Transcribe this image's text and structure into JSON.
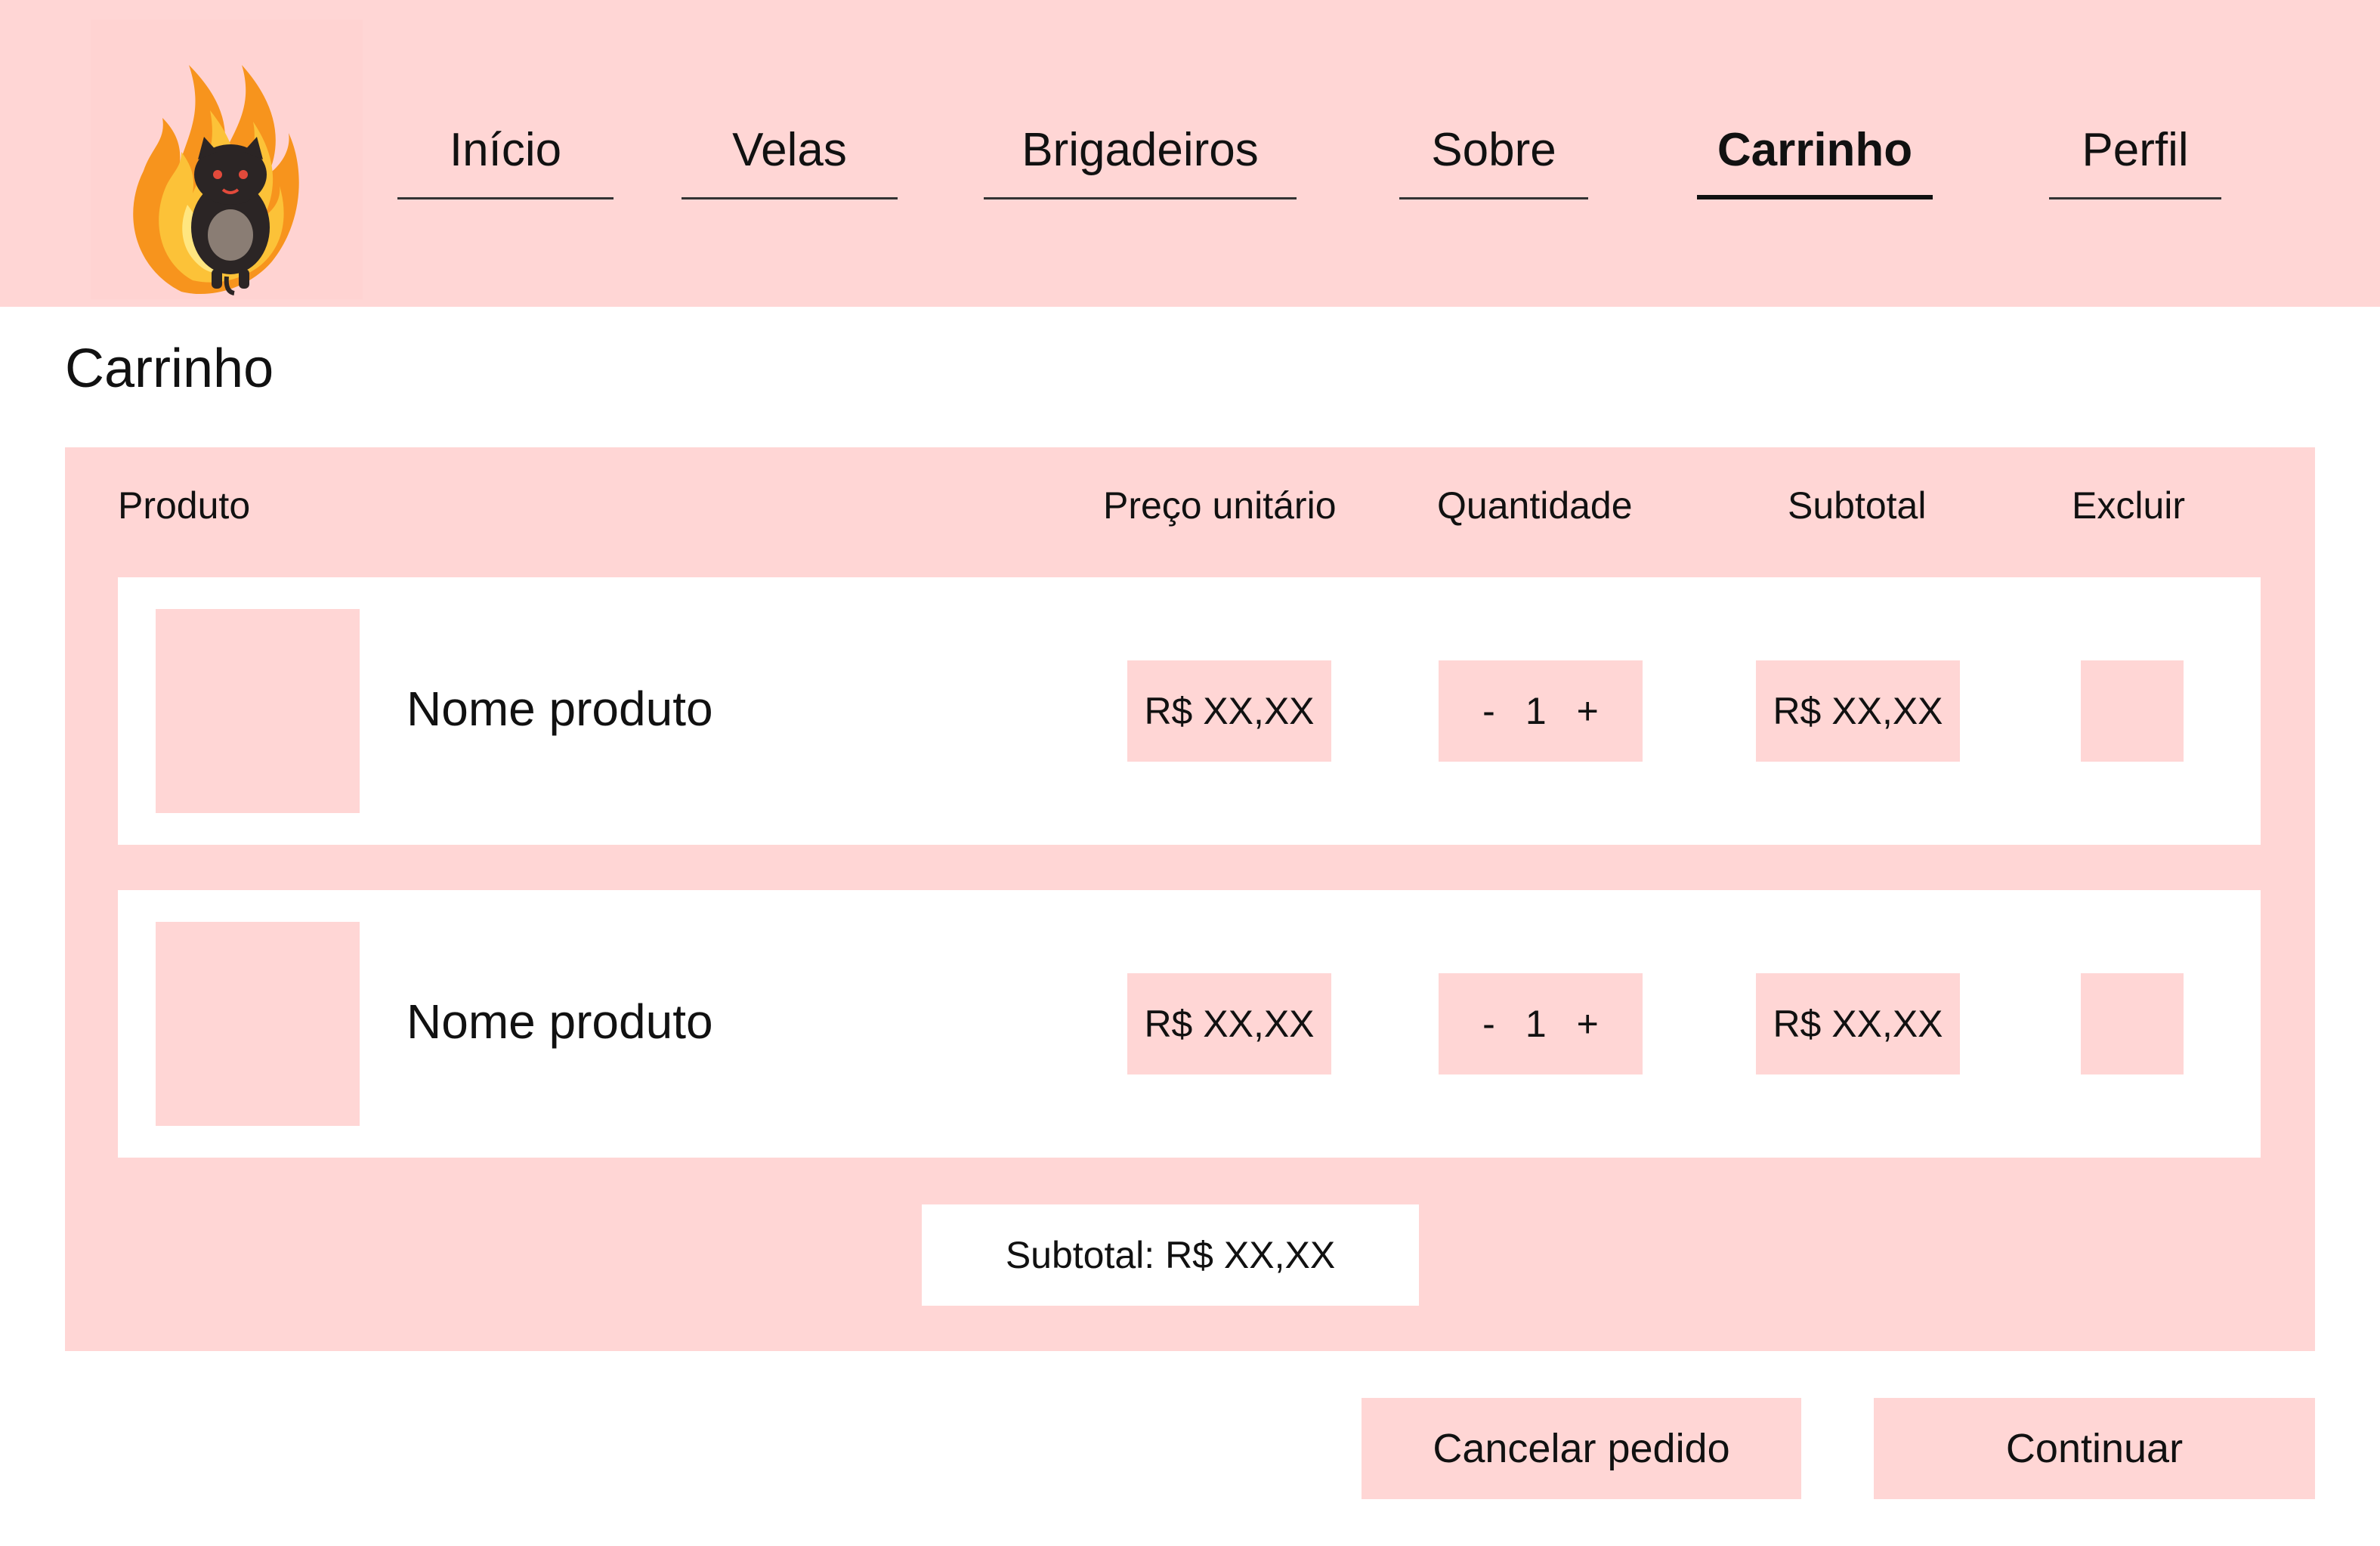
{
  "header": {
    "logo_icon": "flame-cat-logo-icon",
    "nav": [
      {
        "label": "Início",
        "active": false
      },
      {
        "label": "Velas",
        "active": false
      },
      {
        "label": "Brigadeiros",
        "active": false
      },
      {
        "label": "Sobre",
        "active": false
      },
      {
        "label": "Carrinho",
        "active": true
      },
      {
        "label": "Perfil",
        "active": false
      }
    ]
  },
  "page": {
    "title": "Carrinho"
  },
  "cart": {
    "columns": {
      "product": "Produto",
      "unit_price": "Preço unitário",
      "quantity": "Quantidade",
      "subtotal": "Subtotal",
      "delete": "Excluir"
    },
    "items": [
      {
        "name": "Nome produto",
        "unit_price": "R$ XX,XX",
        "qty_minus": "-",
        "quantity": "1",
        "qty_plus": "+",
        "subtotal": "R$ XX,XX"
      },
      {
        "name": "Nome produto",
        "unit_price": "R$ XX,XX",
        "qty_minus": "-",
        "quantity": "1",
        "qty_plus": "+",
        "subtotal": "R$ XX,XX"
      }
    ],
    "total_label": "Subtotal: R$ XX,XX"
  },
  "actions": {
    "cancel_label": "Cancelar pedido",
    "continue_label": "Continuar"
  },
  "colors": {
    "accent_pink": "#ffd6d5",
    "background": "#ffffff",
    "text": "#111111"
  }
}
